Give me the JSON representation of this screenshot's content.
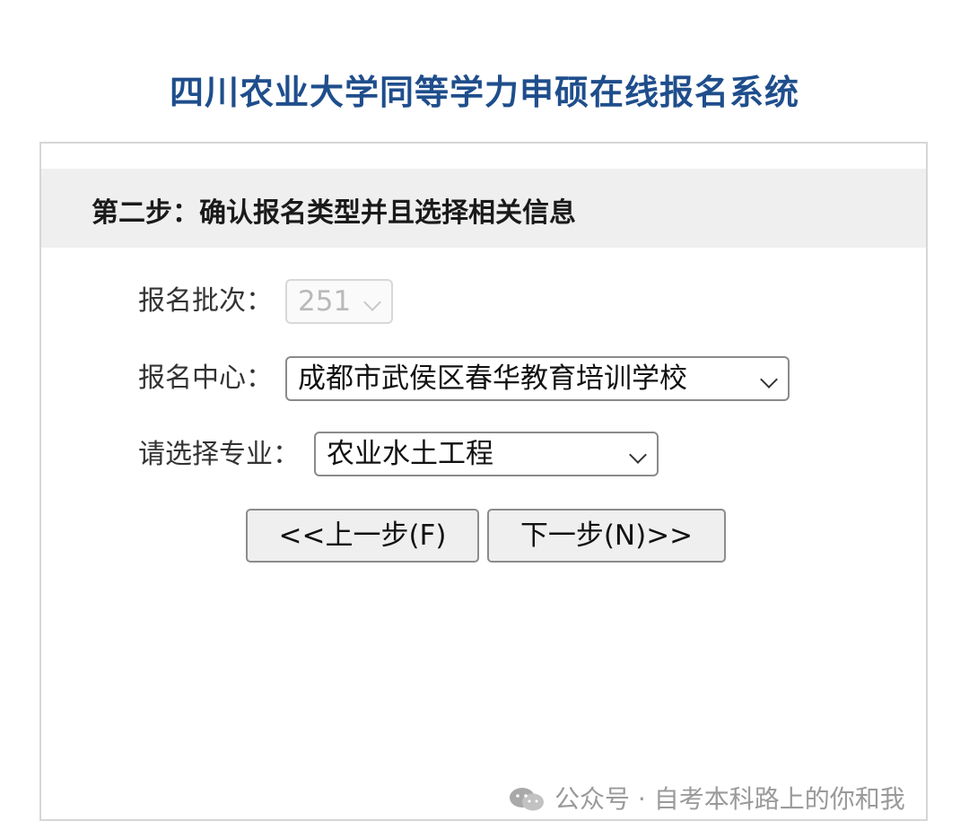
{
  "header": {
    "title": "四川农业大学同等学力申硕在线报名系统"
  },
  "step": {
    "title": "第二步：确认报名类型并且选择相关信息"
  },
  "form": {
    "batch": {
      "label": "报名批次：",
      "value": "251"
    },
    "center": {
      "label": "报名中心：",
      "value": "成都市武侯区春华教育培训学校"
    },
    "major": {
      "label": "请选择专业：",
      "value": "农业水土工程"
    }
  },
  "buttons": {
    "prev": "<<上一步(F)",
    "next": "下一步(N)>>"
  },
  "watermark": {
    "text": "公众号 · 自考本科路上的你和我",
    "icon": "wechat-icon"
  },
  "colors": {
    "title": "#1f4e8c",
    "header_band": "#efefef",
    "button_bg": "#efefef"
  }
}
